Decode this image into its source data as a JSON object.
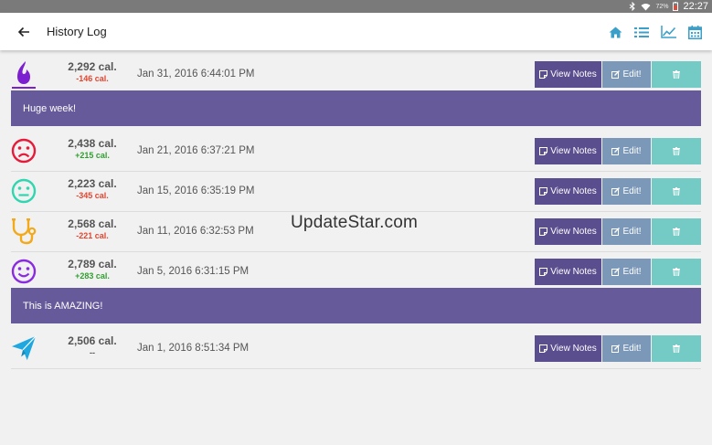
{
  "status_bar": {
    "battery_percent": "72%",
    "time": "22:27"
  },
  "app_bar": {
    "title": "History Log",
    "actions": [
      "home-icon",
      "list-icon",
      "chart-icon",
      "calendar-icon"
    ],
    "accent_color": "#3aa0c9"
  },
  "colors": {
    "notes_button": "#5b4e8f",
    "edit_button": "#7b98b9",
    "delete_button": "#74cbc6",
    "note_banner": "#665a9a",
    "negative_delta": "#e0452f",
    "positive_delta": "#2fa02f"
  },
  "entries": [
    {
      "icon": "flame-icon",
      "calories": "2,292 cal.",
      "delta": "-146 cal.",
      "date": "Jan 31, 2016 6:44:01 PM",
      "note": "Huge week!"
    },
    {
      "icon": "sad-face-icon",
      "calories": "2,438 cal.",
      "delta": "+215 cal.",
      "date": "Jan 21, 2016 6:37:21 PM"
    },
    {
      "icon": "neutral-face-icon",
      "calories": "2,223 cal.",
      "delta": "-345 cal.",
      "date": "Jan 15, 2016 6:35:19 PM"
    },
    {
      "icon": "stethoscope-icon",
      "calories": "2,568 cal.",
      "delta": "-221 cal.",
      "date": "Jan 11, 2016 6:32:53 PM"
    },
    {
      "icon": "happy-face-icon",
      "calories": "2,789 cal.",
      "delta": "+283 cal.",
      "date": "Jan 5, 2016 6:31:15 PM",
      "note": "This is AMAZING!"
    },
    {
      "icon": "paper-plane-icon",
      "calories": "2,506 cal.",
      "delta": "--",
      "date": "Jan 1, 2016 8:51:34 PM"
    }
  ],
  "buttons": {
    "view_notes": "View Notes",
    "edit": "Edit!"
  },
  "watermark": "UpdateStar.com"
}
